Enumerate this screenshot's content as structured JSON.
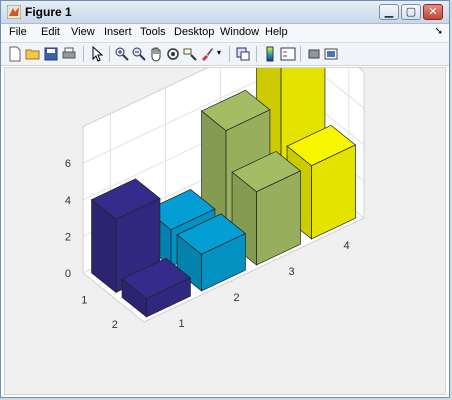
{
  "window": {
    "title": "Figure 1"
  },
  "menus": [
    "File",
    "Edit",
    "View",
    "Insert",
    "Tools",
    "Desktop",
    "Window",
    "Help"
  ],
  "toolbar": {
    "icons": [
      "new-figure-icon",
      "open-file-icon",
      "save-icon",
      "print-icon",
      "pointer-icon",
      "zoom-in-icon",
      "zoom-out-icon",
      "pan-icon",
      "rotate-3d-icon",
      "data-cursor-icon",
      "brush-icon",
      "link-plot-icon",
      "colorbar-icon",
      "legend-icon",
      "hide-plot-tools-icon",
      "show-plot-tools-icon"
    ]
  },
  "chart_data": {
    "type": "bar",
    "subtype": "bar3",
    "rows": [
      1,
      2
    ],
    "columns": [
      1,
      2,
      3,
      4
    ],
    "values": [
      [
        4,
        2,
        6,
        8
      ],
      [
        1,
        2,
        4,
        4
      ]
    ],
    "zlim": [
      0,
      8
    ],
    "z_ticks": [
      "0",
      "2",
      "4",
      "6"
    ],
    "row_tick_labels": [
      "1",
      "2"
    ],
    "column_tick_labels": [
      "1",
      "2",
      "3",
      "4"
    ],
    "column_colors": [
      "#332c8a",
      "#039ed3",
      "#a4bd64",
      "#f8f700"
    ],
    "grid": true
  }
}
